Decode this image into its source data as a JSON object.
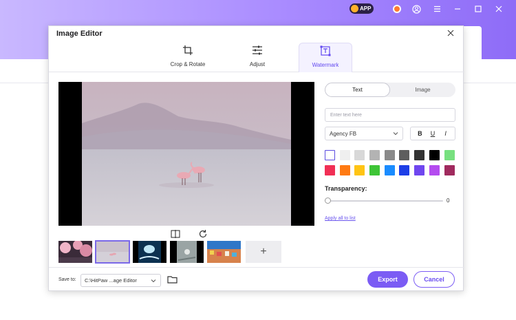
{
  "app": {
    "badge_label": "APP",
    "titlebar_icons": [
      "sale-icon",
      "account-icon",
      "menu-icon",
      "minimize-icon",
      "maximize-icon",
      "close-icon"
    ]
  },
  "dialog": {
    "title": "Image Editor",
    "close_icon": "close-icon",
    "tabs": [
      {
        "label": "Crop & Rotate",
        "icon": "crop-icon",
        "active": false
      },
      {
        "label": "Adjust",
        "icon": "sliders-icon",
        "active": false
      },
      {
        "label": "Watermark",
        "icon": "watermark-icon",
        "active": true
      }
    ]
  },
  "preview": {
    "tools": [
      "flip-icon",
      "rotate-icon"
    ],
    "thumbnails": [
      {
        "name": "cherry-blossom",
        "selected": false
      },
      {
        "name": "flamingos-lake",
        "selected": true
      },
      {
        "name": "jellyfish-blue",
        "selected": false
      },
      {
        "name": "foggy-bird",
        "selected": false
      },
      {
        "name": "colorful-town",
        "selected": false
      }
    ],
    "add_label": "+"
  },
  "watermark": {
    "mode_options": [
      "Text",
      "Image"
    ],
    "selected_mode": "Text",
    "text_placeholder": "Enter text here",
    "font": "Agency FB",
    "style_buttons": [
      "B",
      "U",
      "I"
    ],
    "colors": [
      "#ffffff",
      "#efefef",
      "#d8d8d8",
      "#b3b3b3",
      "#8a8a8a",
      "#5e5e5e",
      "#333333",
      "#000000",
      "#77e07f",
      "#f12f55",
      "#ff7a12",
      "#ffc414",
      "#3ec536",
      "#1a8cff",
      "#1d3ee6",
      "#6f46ef",
      "#b44bef",
      "#a02a5e"
    ],
    "selected_color": "#ffffff",
    "transparency_label": "Transparency:",
    "transparency_value": "0",
    "apply_link": "Apply all to list"
  },
  "footer": {
    "save_label": "Save to:",
    "save_path": "C:\\HitPaw ...age Editor",
    "export_label": "Export",
    "cancel_label": "Cancel"
  }
}
